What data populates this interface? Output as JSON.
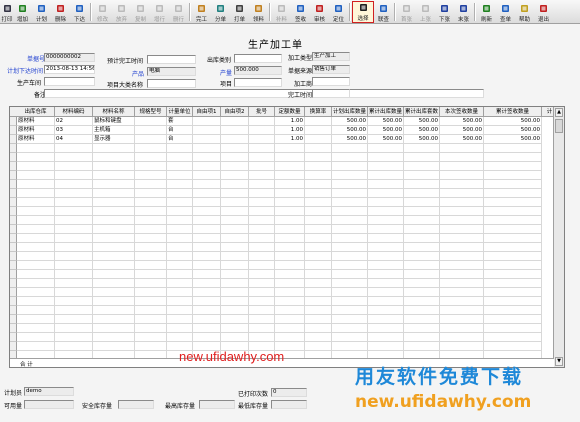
{
  "toolbar": [
    {
      "label": "打印",
      "icon": "printer-icon",
      "dis": false
    },
    {
      "label": "增加",
      "icon": "add-icon",
      "dis": false
    },
    {
      "label": "计划",
      "icon": "plan-icon",
      "dis": false
    },
    {
      "label": "删除",
      "icon": "delete-icon",
      "dis": false
    },
    {
      "label": "下达",
      "icon": "release-icon",
      "dis": false
    },
    {
      "label": "修改",
      "icon": "edit-icon",
      "dis": true
    },
    {
      "label": "放弃",
      "icon": "abandon-icon",
      "dis": true
    },
    {
      "label": "复制",
      "icon": "copy-icon",
      "dis": true
    },
    {
      "label": "增行",
      "icon": "add-row-icon",
      "dis": true
    },
    {
      "label": "删行",
      "icon": "delete-row-icon",
      "dis": true
    },
    {
      "label": "完工",
      "icon": "complete-icon",
      "dis": false
    },
    {
      "label": "分单",
      "icon": "split-icon",
      "dis": false
    },
    {
      "label": "打单",
      "icon": "print-doc-icon",
      "dis": false
    },
    {
      "label": "领料",
      "icon": "material-icon",
      "dis": false
    },
    {
      "label": "补料",
      "icon": "supply-icon",
      "dis": true
    },
    {
      "label": "签收",
      "icon": "receipt-icon",
      "dis": false
    },
    {
      "label": "审核",
      "icon": "audit-icon",
      "dis": false
    },
    {
      "label": "定位",
      "icon": "locate-icon",
      "dis": false
    },
    {
      "label": "选择",
      "icon": "select-icon",
      "dis": false,
      "active": true
    },
    {
      "label": "联查",
      "icon": "query-icon",
      "dis": false
    },
    {
      "label": "首张",
      "icon": "first-icon",
      "dis": true
    },
    {
      "label": "上张",
      "icon": "prev-icon",
      "dis": true
    },
    {
      "label": "下张",
      "icon": "next-icon",
      "dis": false
    },
    {
      "label": "末张",
      "icon": "last-icon",
      "dis": false
    },
    {
      "label": "刷新",
      "icon": "refresh-icon",
      "dis": false
    },
    {
      "label": "查单",
      "icon": "search-doc-icon",
      "dis": false
    },
    {
      "label": "帮助",
      "icon": "help-icon",
      "dis": false
    },
    {
      "label": "退出",
      "icon": "exit-icon",
      "dis": false
    }
  ],
  "header": {
    "title": "生产加工单",
    "doc_no_label": "单据号",
    "doc_no": "0000000002",
    "plan_time_label": "计划下达时间",
    "plan_time": "2013-08-13 14:56",
    "workshop_label": "生产车间",
    "workshop": "",
    "remark_label": "备注",
    "remark": "",
    "est_finish_label": "预计完工时间",
    "est_finish": "",
    "product_label": "产品",
    "product": "电脑",
    "project_cat_label": "项目大类名称",
    "project_cat": "",
    "out_type_label": "出库类别",
    "out_type": "",
    "qty_label": "产量",
    "qty": "500.000",
    "project_label": "项目",
    "project": "",
    "proc_type_label": "加工类型",
    "proc_type": "生产加工",
    "doc_src_label": "单据来源",
    "doc_src": "销售订单",
    "proc_acct_label": "加工商",
    "proc_acct": "",
    "finish_time_label": "完工时间",
    "finish_time": ""
  },
  "table": {
    "columns": [
      "出库仓库",
      "材料编码",
      "材料名称",
      "规格型号",
      "计量单位",
      "自由项1",
      "自由项2",
      "批号",
      "定额数量",
      "换算率",
      "计划出库数量",
      "累计出库数量",
      "累计出库套数",
      "本次签收数量",
      "累计签收数量",
      "计"
    ],
    "rows": [
      [
        "原材料",
        "02",
        "鼠标和键盘",
        "",
        "套",
        "",
        "",
        "",
        "1.00",
        "",
        "500.00",
        "500.00",
        "500.00",
        "500.00",
        "500.00"
      ],
      [
        "原材料",
        "03",
        "主机箱",
        "",
        "台",
        "",
        "",
        "",
        "1.00",
        "",
        "500.00",
        "500.00",
        "500.00",
        "500.00",
        "500.00"
      ],
      [
        "原材料",
        "04",
        "显示器",
        "",
        "台",
        "",
        "",
        "",
        "1.00",
        "",
        "500.00",
        "500.00",
        "500.00",
        "500.00",
        "500.00"
      ]
    ],
    "sum_label": "合  计"
  },
  "footer": {
    "planner_label": "计划员",
    "planner": "demo",
    "printed_label": "已打印次数",
    "printed": "0",
    "avail_label": "可用量",
    "avail": "",
    "safety_label": "安全库存量",
    "safety": "",
    "max_label": "最高库存量",
    "max": "",
    "min_label": "最低库存量",
    "min": ""
  },
  "watermarks": {
    "top": "new.ufidawhy.com",
    "cn": "用友软件免费下载",
    "bottom": "new.ufidawhy.com"
  }
}
